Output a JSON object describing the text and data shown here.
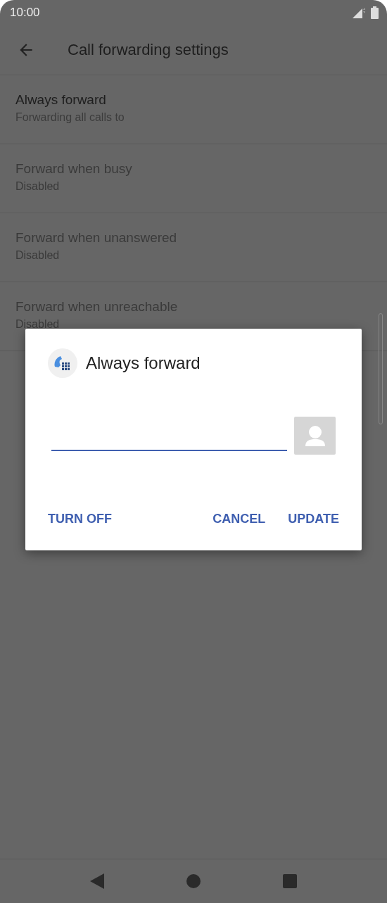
{
  "status_bar": {
    "time": "10:00"
  },
  "toolbar": {
    "title": "Call forwarding settings"
  },
  "settings": [
    {
      "title": "Always forward",
      "summary": "Forwarding all calls to",
      "disabled": false
    },
    {
      "title": "Forward when busy",
      "summary": "Disabled",
      "disabled": true
    },
    {
      "title": "Forward when unanswered",
      "summary": "Disabled",
      "disabled": true
    },
    {
      "title": "Forward when unreachable",
      "summary": "Disabled",
      "disabled": true
    }
  ],
  "dialog": {
    "title": "Always forward",
    "buttons": [
      {
        "label": "TURN OFF",
        "kind": "left"
      },
      {
        "label": "CANCEL",
        "kind": "right"
      },
      {
        "label": "UPDATE",
        "kind": "right"
      }
    ]
  }
}
